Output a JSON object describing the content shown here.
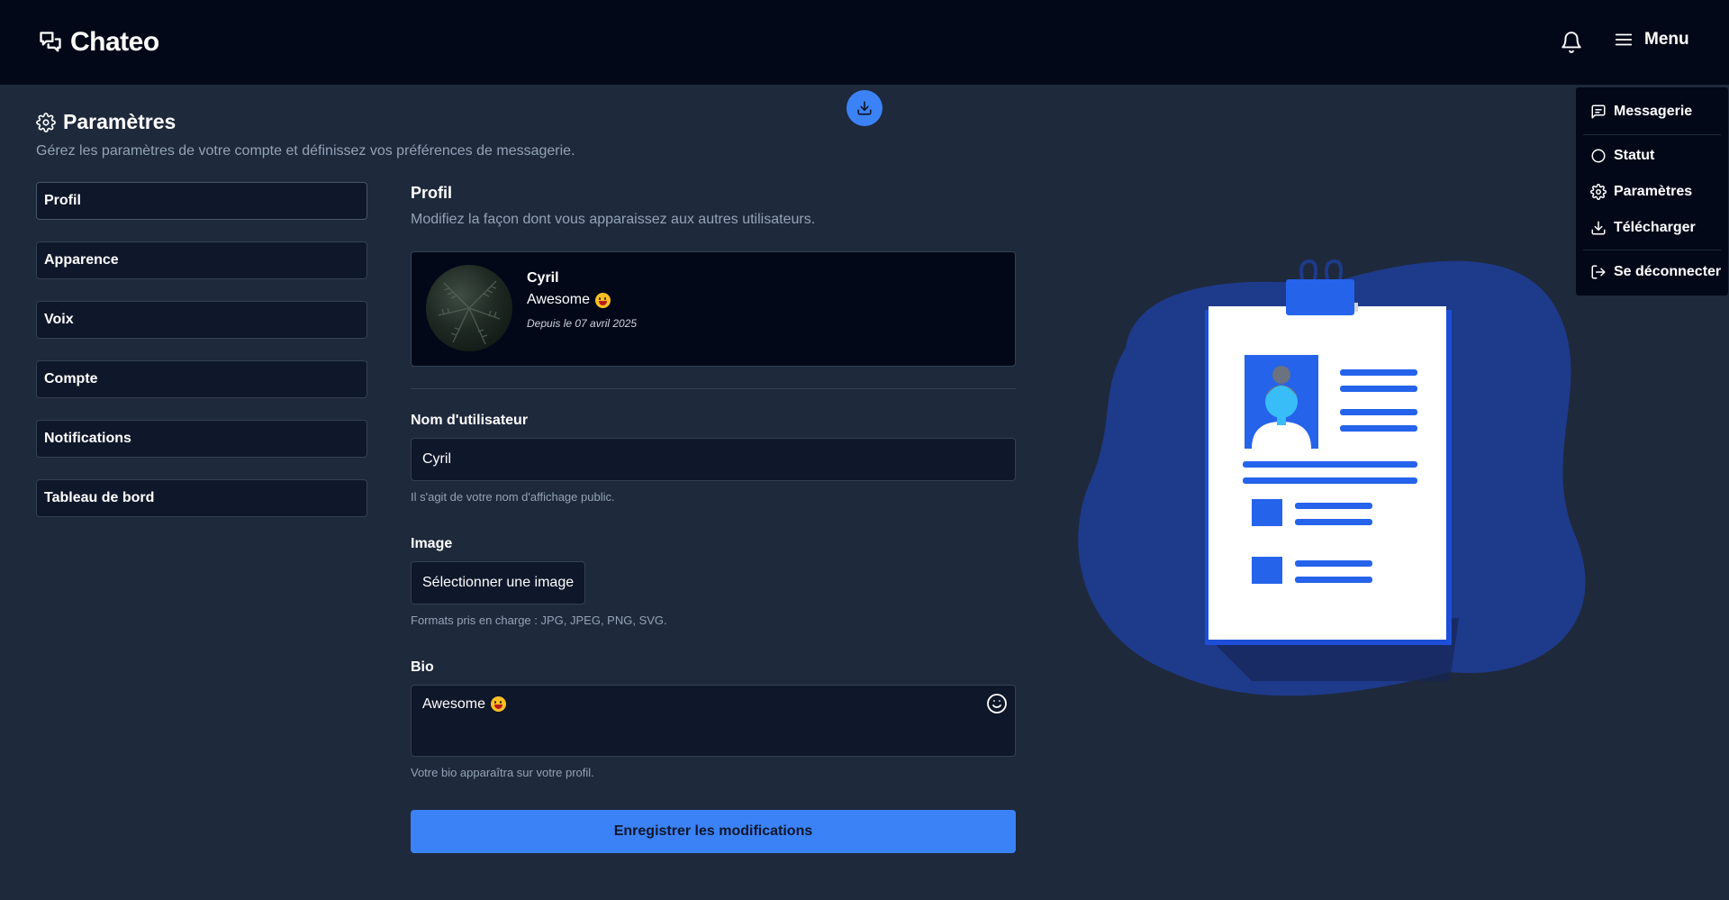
{
  "header": {
    "app_name": "Chateo",
    "menu_label": "Menu"
  },
  "page": {
    "title": "Paramètres",
    "subtitle": "Gérez les paramètres de votre compte et définissez vos préférences de messagerie."
  },
  "sidebar": {
    "items": [
      {
        "label": "Profil"
      },
      {
        "label": "Apparence"
      },
      {
        "label": "Voix"
      },
      {
        "label": "Compte"
      },
      {
        "label": "Notifications"
      },
      {
        "label": "Tableau de bord"
      }
    ]
  },
  "profile_section": {
    "title": "Profil",
    "subtitle": "Modifiez la façon dont vous apparaissez aux autres utilisateurs.",
    "card": {
      "name": "Cyril",
      "bio": "Awesome",
      "since": "Depuis le 07 avril 2025"
    }
  },
  "form": {
    "username": {
      "label": "Nom d'utilisateur",
      "value": "Cyril",
      "help": "Il s'agit de votre nom d'affichage public."
    },
    "image": {
      "label": "Image",
      "button": "Sélectionner une image",
      "help": "Formats pris en charge : JPG, JPEG, PNG, SVG."
    },
    "bio": {
      "label": "Bio",
      "value": "Awesome",
      "help": "Votre bio apparaîtra sur votre profil."
    },
    "save_label": "Enregistrer les modifications"
  },
  "dropdown": {
    "items": [
      {
        "label": "Messagerie",
        "icon": "message-square-icon"
      },
      {
        "label": "Statut",
        "icon": "circle-icon"
      },
      {
        "label": "Paramètres",
        "icon": "gear-icon"
      },
      {
        "label": "Télécharger",
        "icon": "download-icon"
      },
      {
        "label": "Se déconnecter",
        "icon": "logout-icon"
      }
    ]
  },
  "colors": {
    "background": "#1e293b",
    "header": "#020817",
    "accent": "#3b82f6",
    "illustration_blob": "#1e3a8a",
    "illustration_accent": "#2563eb"
  }
}
